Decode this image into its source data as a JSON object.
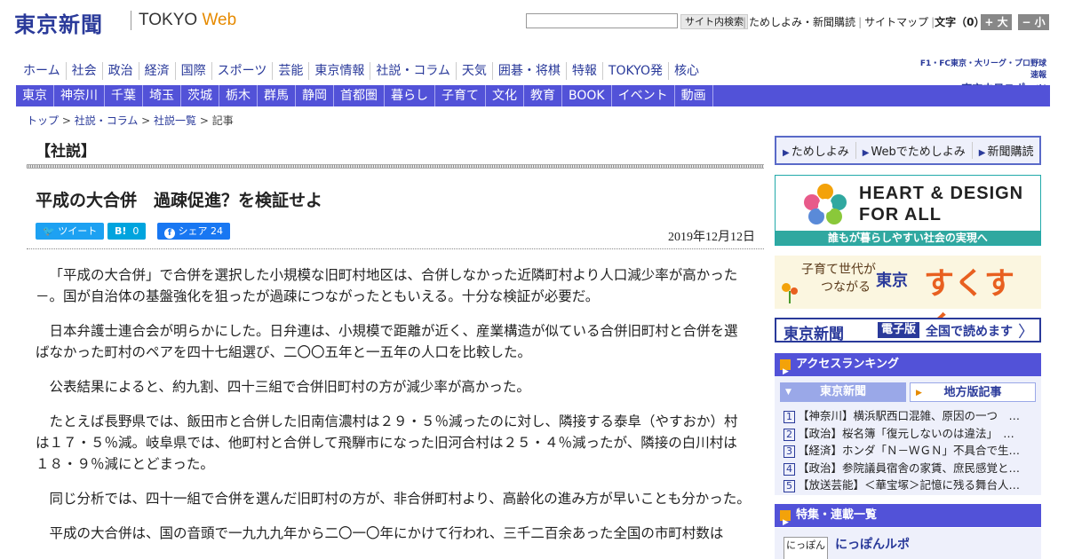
{
  "header": {
    "logo_jp": "東京新聞",
    "logo_en_a": "TOKYO",
    "logo_en_b": "Web",
    "search_placeholder": "",
    "search_button": "サイト内検索",
    "links": [
      "ためしよみ・新聞購読",
      "サイトマップ"
    ],
    "font_label": "文字（0）",
    "font_bigger": "+ 大",
    "font_smaller": "− 小"
  },
  "nav_main": [
    "ホーム",
    "社会",
    "政治",
    "経済",
    "国際",
    "スポーツ",
    "芸能",
    "東京情報",
    "社説・コラム",
    "天気",
    "囲碁・将棋",
    "特報",
    "TOKYO発",
    "核心"
  ],
  "chunichi": {
    "line1": "F1・FC東京・大リーグ・プロ野球速報",
    "line2": "東京中日スポーツ"
  },
  "nav_region": [
    "東京",
    "神奈川",
    "千葉",
    "埼玉",
    "茨城",
    "栃木",
    "群馬",
    "静岡",
    "首都圏",
    "暮らし",
    "子育て",
    "文化",
    "教育",
    "BOOK",
    "イベント",
    "動画"
  ],
  "breadcrumb": {
    "items": [
      "トップ",
      "社説・コラム",
      "社説一覧"
    ],
    "current": "記事",
    "sep": " > "
  },
  "article": {
    "section": "【社説】",
    "title": "平成の大合併　過疎促進？を検証せよ",
    "share": {
      "tweet": "ツイート",
      "hatena": "B!",
      "hatena_count": "0",
      "fb_share": "シェア",
      "fb_count": "24"
    },
    "date": "2019年12月12日",
    "paragraphs": [
      "「平成の大合併」で合併を選択した小規模な旧町村地区は、合併しなかった近隣町村より人口減少率が高かった－。国が自治体の基盤強化を狙ったが過疎につながったともいえる。十分な検証が必要だ。",
      "日本弁護士連合会が明らかにした。日弁連は、小規模で距離が近く、産業構造が似ている合併旧町村と合併を選ばなかった町村のペアを四十七組選び、二〇〇五年と一五年の人口を比較した。",
      "公表結果によると、約九割、四十三組で合併旧町村の方が減少率が高かった。",
      "たとえば長野県では、飯田市と合併した旧南信濃村は２９・５％減ったのに対し、隣接する泰阜（やすおか）村は１７・５％減。岐阜県では、他町村と合併して飛騨市になった旧河合村は２５・４％減ったが、隣接の白川村は１８・９％減にとどまった。",
      "同じ分析では、四十一組で合併を選んだ旧町村の方が、非合併町村より、高齢化の進み方が早いことも分かった。",
      "平成の大合併は、国の音頭で一九九九年から二〇一〇年にかけて行われ、三千二百余あった全国の市町村数は"
    ]
  },
  "sidebar": {
    "promo1": [
      "ためしよみ",
      "Webでためしよみ",
      "新聞購読"
    ],
    "heart": {
      "title_a": "HEART & DESIGN",
      "title_b": "FOR ALL",
      "caption": "誰もが暮らしやすい社会の実現へ"
    },
    "sukusuku": {
      "sub_a": "子育て世代が",
      "sub_b": "つながる",
      "place": "東京",
      "main": "すくすく"
    },
    "digital": {
      "logo": "東京新聞",
      "badge": "電子版",
      "text": "全国で読めます",
      "arrow": "〉"
    },
    "ranking": {
      "title": "アクセスランキング",
      "tab_a": "東京新聞",
      "tab_b": "地方版記事",
      "items": [
        "【神奈川】横浜駅西口混雑、原因の一つ　…",
        "【政治】桜名簿「復元しないのは違法」　…",
        "【経済】ホンダ「Ｎ－ＷＧＮ」不具合で生…",
        "【政治】参院議員宿舎の家賃、庶民感覚と…",
        "【放送芸能】＜華宝塚＞記憶に残る舞台人…"
      ]
    },
    "features": {
      "title": "特集・連載一覧",
      "item": "にっぽんルポ",
      "icon_text": "にっぽん"
    }
  },
  "colors": {
    "nav_blue": "#5252d8",
    "brand_blue": "#2a3a9a",
    "orange": "#e68a00",
    "twitter": "#1da1f2",
    "hatena": "#00a4de",
    "facebook": "#1877f2"
  }
}
